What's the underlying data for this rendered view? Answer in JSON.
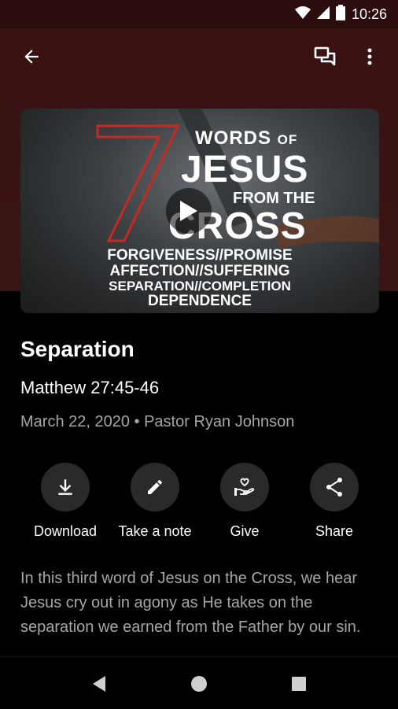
{
  "status_bar": {
    "time": "10:26",
    "icons": [
      "wifi-icon",
      "cell-signal-icon",
      "battery-icon"
    ]
  },
  "app_bar": {
    "icons": [
      "back-arrow-icon",
      "chat-icon",
      "more-vert-icon"
    ]
  },
  "video": {
    "art_text": {
      "number": "7",
      "words": "WORDS",
      "of": "OF",
      "jesus": "JESUS",
      "from_the": "FROM THE",
      "cross": "CROSS"
    },
    "topics": [
      "FORGIVENESS//PROMISE",
      "AFFECTION//SUFFERING",
      "SEPARATION//COMPLETION",
      "DEPENDENCE"
    ],
    "play_icon": "play-icon"
  },
  "sermon": {
    "title": "Separation",
    "scripture": "Matthew 27:45-46",
    "meta": "March 22, 2020 • Pastor Ryan Johnson",
    "description": "In this third word of Jesus on the Cross, we hear Jesus cry out in agony as He takes on the separation we earned from the Father by our sin."
  },
  "actions": [
    {
      "label": "Download",
      "icon": "download-icon"
    },
    {
      "label": "Take a note",
      "icon": "pencil-icon"
    },
    {
      "label": "Give",
      "icon": "give-heart-hand-icon"
    },
    {
      "label": "Share",
      "icon": "share-icon"
    }
  ],
  "colors": {
    "header_bg": "#3a1213",
    "status_bg": "#2b0d0e",
    "accent_red": "#c62a22",
    "muted_text": "#a6a6a6",
    "button_bg": "#2a2a2a"
  }
}
